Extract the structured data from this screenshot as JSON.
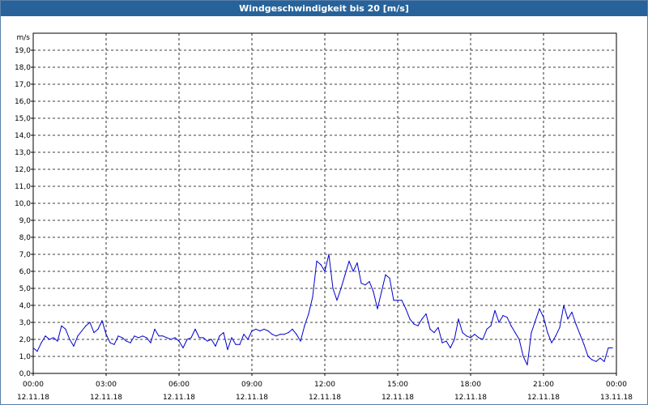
{
  "window": {
    "title": "Windgeschwindigkeit bis 20 [m/s]"
  },
  "colors": {
    "titlebar": "#27639a",
    "series": "#0000cc",
    "grid": "#000000",
    "background": "#ffffff"
  },
  "chart_data": {
    "type": "line",
    "title": "Windgeschwindigkeit bis 20 [m/s]",
    "ylabel": "m/s",
    "xlabel": "",
    "ylim": [
      0,
      20
    ],
    "y_ticks": [
      "0,0",
      "1,0",
      "2,0",
      "3,0",
      "4,0",
      "5,0",
      "6,0",
      "7,0",
      "8,0",
      "9,0",
      "10,0",
      "11,0",
      "12,0",
      "13,0",
      "14,0",
      "15,0",
      "16,0",
      "17,0",
      "18,0",
      "19,0"
    ],
    "x_range": [
      "12.11.18 00:00",
      "13.11.18 00:00"
    ],
    "x_ticks": [
      {
        "time": "00:00",
        "date": "12.11.18"
      },
      {
        "time": "03:00",
        "date": "12.11.18"
      },
      {
        "time": "06:00",
        "date": "12.11.18"
      },
      {
        "time": "09:00",
        "date": "12.11.18"
      },
      {
        "time": "12:00",
        "date": "12.11.18"
      },
      {
        "time": "15:00",
        "date": "12.11.18"
      },
      {
        "time": "18:00",
        "date": "12.11.18"
      },
      {
        "time": "21:00",
        "date": "12.11.18"
      },
      {
        "time": "00:00",
        "date": "13.11.18"
      }
    ],
    "grid": "dashed",
    "series": [
      {
        "time": [
          "00:00",
          "00:10",
          "00:20",
          "00:30",
          "00:40",
          "00:50",
          "01:00",
          "01:10",
          "01:20",
          "01:30",
          "01:40",
          "01:50",
          "02:00",
          "02:10",
          "02:20",
          "02:30",
          "02:40",
          "02:50",
          "03:00",
          "03:10",
          "03:20",
          "03:30",
          "03:40",
          "03:50",
          "04:00",
          "04:10",
          "04:20",
          "04:30",
          "04:40",
          "04:50",
          "05:00",
          "05:10",
          "05:20",
          "05:30",
          "05:40",
          "05:50",
          "06:00",
          "06:10",
          "06:20",
          "06:30",
          "06:40",
          "06:50",
          "07:00",
          "07:10",
          "07:20",
          "07:30",
          "07:40",
          "07:50",
          "08:00",
          "08:10",
          "08:20",
          "08:30",
          "08:40",
          "08:50",
          "09:00",
          "09:10",
          "09:20",
          "09:30",
          "09:40",
          "09:50",
          "10:00",
          "10:10",
          "10:20",
          "10:30",
          "10:40",
          "10:50",
          "11:00",
          "11:10",
          "11:20",
          "11:30",
          "11:40",
          "11:50",
          "12:00",
          "12:10",
          "12:20",
          "12:30",
          "12:40",
          "12:50",
          "13:00",
          "13:10",
          "13:20",
          "13:30",
          "13:40",
          "13:50",
          "14:00",
          "14:10",
          "14:20",
          "14:30",
          "14:40",
          "14:50",
          "15:00",
          "15:10",
          "15:20",
          "15:30",
          "15:40",
          "15:50",
          "16:00",
          "16:10",
          "16:20",
          "16:30",
          "16:40",
          "16:50",
          "17:00",
          "17:10",
          "17:20",
          "17:30",
          "17:40",
          "17:50",
          "18:00",
          "18:10",
          "18:20",
          "18:30",
          "18:40",
          "18:50",
          "19:00",
          "19:10",
          "19:20",
          "19:30",
          "19:40",
          "19:50",
          "20:00",
          "20:10",
          "20:20",
          "20:30",
          "20:40",
          "20:50",
          "21:00",
          "21:10",
          "21:20",
          "21:30",
          "21:40",
          "21:50",
          "22:00",
          "22:10",
          "22:20",
          "22:30",
          "22:40",
          "22:50",
          "23:00",
          "23:10",
          "23:20",
          "23:30",
          "23:40",
          "23:50"
        ],
        "values": [
          1.5,
          1.3,
          1.8,
          2.2,
          2.0,
          2.1,
          1.9,
          2.8,
          2.6,
          2.0,
          1.6,
          2.2,
          2.5,
          2.8,
          3.0,
          2.4,
          2.6,
          3.1,
          2.3,
          1.8,
          1.7,
          2.2,
          2.1,
          1.9,
          1.8,
          2.2,
          2.1,
          2.2,
          2.1,
          1.8,
          2.6,
          2.2,
          2.2,
          2.1,
          2.0,
          2.1,
          1.9,
          1.5,
          2.0,
          2.1,
          2.6,
          2.1,
          2.1,
          1.9,
          2.0,
          1.6,
          2.2,
          2.4,
          1.4,
          2.1,
          1.7,
          1.7,
          2.3,
          2.0,
          2.5,
          2.6,
          2.5,
          2.6,
          2.5,
          2.3,
          2.2,
          2.3,
          2.3,
          2.4,
          2.6,
          2.3,
          1.9,
          2.8,
          3.5,
          4.5,
          6.6,
          6.4,
          6.0,
          7.0,
          5.0,
          4.3,
          5.0,
          5.8,
          6.6,
          6.0,
          6.5,
          5.3,
          5.2,
          5.4,
          4.8,
          3.8,
          4.8,
          5.8,
          5.6,
          4.3,
          4.3,
          4.3,
          3.8,
          3.2,
          2.9,
          2.8,
          3.2,
          3.5,
          2.6,
          2.4,
          2.7,
          1.8,
          1.9,
          1.5,
          2.0,
          3.2,
          2.4,
          2.2,
          2.1,
          2.3,
          2.1,
          2.0,
          2.6,
          2.8,
          3.7,
          3.0,
          3.4,
          3.3,
          2.8,
          2.4,
          2.0,
          1.0,
          0.5,
          2.4,
          3.1,
          3.8,
          3.3,
          2.4,
          1.8,
          2.2,
          2.7,
          4.0,
          3.2,
          3.6,
          2.9,
          2.3,
          1.7,
          1.0,
          0.8,
          0.7,
          0.9,
          0.7,
          1.5,
          1.5
        ]
      }
    ]
  }
}
